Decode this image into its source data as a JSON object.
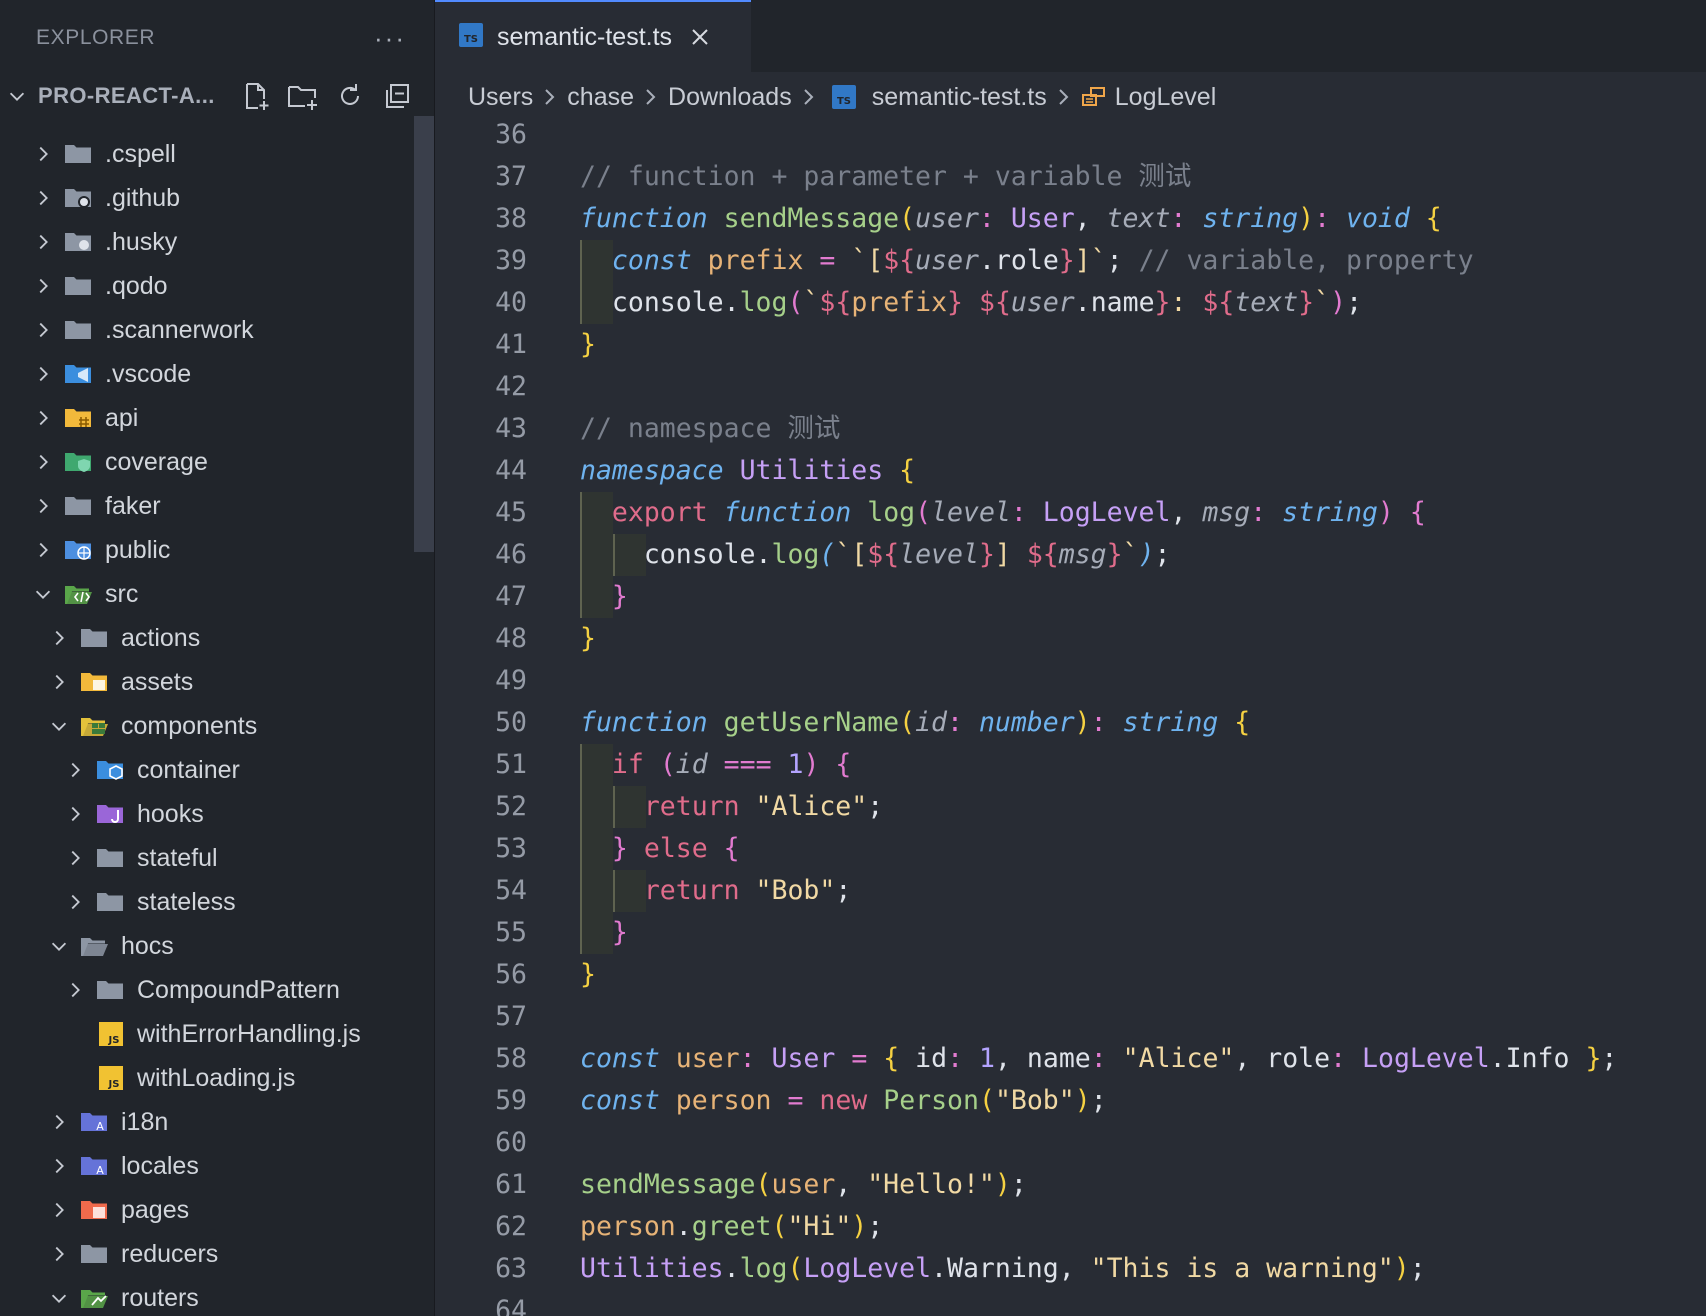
{
  "sidebar": {
    "title": "EXPLORER",
    "more": "···",
    "project": "PRO-REACT-A...",
    "items": [
      {
        "label": ".cspell",
        "depth": 0,
        "expanded": false,
        "icon": "folder-icon",
        "color": "#8d96a4"
      },
      {
        "label": ".github",
        "depth": 0,
        "expanded": false,
        "icon": "github-folder-icon",
        "color": "#8d96a4"
      },
      {
        "label": ".husky",
        "depth": 0,
        "expanded": false,
        "icon": "husky-folder-icon",
        "color": "#8d96a4"
      },
      {
        "label": ".qodo",
        "depth": 0,
        "expanded": false,
        "icon": "folder-icon",
        "color": "#8d96a4"
      },
      {
        "label": ".scannerwork",
        "depth": 0,
        "expanded": false,
        "icon": "folder-icon",
        "color": "#8d96a4"
      },
      {
        "label": ".vscode",
        "depth": 0,
        "expanded": false,
        "icon": "vscode-folder-icon",
        "color": "#3b8ede"
      },
      {
        "label": "api",
        "depth": 0,
        "expanded": false,
        "icon": "api-folder-icon",
        "color": "#f2b93b"
      },
      {
        "label": "coverage",
        "depth": 0,
        "expanded": false,
        "icon": "coverage-folder-icon",
        "color": "#3fa86f"
      },
      {
        "label": "faker",
        "depth": 0,
        "expanded": false,
        "icon": "folder-icon",
        "color": "#8d96a4"
      },
      {
        "label": "public",
        "depth": 0,
        "expanded": false,
        "icon": "public-folder-icon",
        "color": "#4d8fe0"
      },
      {
        "label": "src",
        "depth": 0,
        "expanded": true,
        "icon": "src-folder-icon",
        "color": "#5aa64a"
      },
      {
        "label": "actions",
        "depth": 1,
        "expanded": false,
        "icon": "folder-icon",
        "color": "#8d96a4"
      },
      {
        "label": "assets",
        "depth": 1,
        "expanded": false,
        "icon": "assets-folder-icon",
        "color": "#f2b93b"
      },
      {
        "label": "components",
        "depth": 1,
        "expanded": true,
        "icon": "components-folder-icon",
        "color": "#e3c13b"
      },
      {
        "label": "container",
        "depth": 2,
        "expanded": false,
        "icon": "container-folder-icon",
        "color": "#3b8ede"
      },
      {
        "label": "hooks",
        "depth": 2,
        "expanded": false,
        "icon": "hooks-folder-icon",
        "color": "#9a66d8"
      },
      {
        "label": "stateful",
        "depth": 2,
        "expanded": false,
        "icon": "folder-icon",
        "color": "#8d96a4"
      },
      {
        "label": "stateless",
        "depth": 2,
        "expanded": false,
        "icon": "folder-icon",
        "color": "#8d96a4"
      },
      {
        "label": "hocs",
        "depth": 1,
        "expanded": true,
        "icon": "folder-open-icon",
        "color": "#8d96a4"
      },
      {
        "label": "CompoundPattern",
        "depth": 2,
        "expanded": false,
        "icon": "folder-icon",
        "color": "#8d96a4"
      },
      {
        "label": "withErrorHandling.js",
        "depth": 2,
        "file": true,
        "icon": "js-file-icon",
        "color": "#f1c232"
      },
      {
        "label": "withLoading.js",
        "depth": 2,
        "file": true,
        "icon": "js-file-icon",
        "color": "#f1c232"
      },
      {
        "label": "i18n",
        "depth": 1,
        "expanded": false,
        "icon": "i18n-folder-icon",
        "color": "#6573d8"
      },
      {
        "label": "locales",
        "depth": 1,
        "expanded": false,
        "icon": "locales-folder-icon",
        "color": "#6573d8"
      },
      {
        "label": "pages",
        "depth": 1,
        "expanded": false,
        "icon": "pages-folder-icon",
        "color": "#ef6a4c"
      },
      {
        "label": "reducers",
        "depth": 1,
        "expanded": false,
        "icon": "folder-icon",
        "color": "#8d96a4"
      },
      {
        "label": "routers",
        "depth": 1,
        "expanded": true,
        "icon": "routers-folder-icon",
        "color": "#5aa64a"
      }
    ]
  },
  "tab": {
    "label": "semantic-test.ts",
    "badge": "TS"
  },
  "breadcrumbs": {
    "parts": [
      "Users",
      "chase",
      "Downloads"
    ],
    "file": "semantic-test.ts",
    "file_badge": "TS",
    "symbol": "LogLevel"
  },
  "code": {
    "first_line": 36,
    "lines": [
      [],
      [
        [
          "c",
          "// function + parameter + variable 测试"
        ]
      ],
      [
        [
          "k",
          "function"
        ],
        [
          "pl",
          " "
        ],
        [
          "f",
          "sendMessage"
        ],
        [
          "y",
          "("
        ],
        [
          "p",
          "user"
        ],
        [
          "o",
          ":"
        ],
        [
          "pl",
          " "
        ],
        [
          "t",
          "User"
        ],
        [
          "pl",
          ", "
        ],
        [
          "p",
          "text"
        ],
        [
          "o",
          ":"
        ],
        [
          "pl",
          " "
        ],
        [
          "k",
          "string"
        ],
        [
          "y",
          ")"
        ],
        [
          "o",
          ":"
        ],
        [
          "pl",
          " "
        ],
        [
          "k",
          "void"
        ],
        [
          "pl",
          " "
        ],
        [
          "y",
          "{"
        ]
      ],
      [
        [
          "pl",
          "  "
        ],
        [
          "k",
          "const"
        ],
        [
          "pl",
          " "
        ],
        [
          "v",
          "prefix"
        ],
        [
          "pl",
          " "
        ],
        [
          "o",
          "="
        ],
        [
          "pl",
          " "
        ],
        [
          "s",
          "`["
        ],
        [
          "r",
          "${"
        ],
        [
          "p",
          "user"
        ],
        [
          "pl",
          "."
        ],
        [
          "pl",
          "role"
        ],
        [
          "r",
          "}"
        ],
        [
          "s",
          "]`"
        ],
        [
          "pl",
          "; "
        ],
        [
          "c",
          "// variable, property"
        ]
      ],
      [
        [
          "pl",
          "  "
        ],
        [
          "pl",
          "console"
        ],
        [
          "pl",
          "."
        ],
        [
          "f",
          "log"
        ],
        [
          "o",
          "("
        ],
        [
          "s",
          "`"
        ],
        [
          "r",
          "${"
        ],
        [
          "v",
          "prefix"
        ],
        [
          "r",
          "}"
        ],
        [
          "s",
          " "
        ],
        [
          "r",
          "${"
        ],
        [
          "p",
          "user"
        ],
        [
          "pl",
          "."
        ],
        [
          "pl",
          "name"
        ],
        [
          "r",
          "}"
        ],
        [
          "s",
          ": "
        ],
        [
          "r",
          "${"
        ],
        [
          "p",
          "text"
        ],
        [
          "r",
          "}"
        ],
        [
          "s",
          "`"
        ],
        [
          "o",
          ")"
        ],
        [
          "pl",
          ";"
        ]
      ],
      [
        [
          "y",
          "}"
        ]
      ],
      [],
      [
        [
          "c",
          "// namespace 测试"
        ]
      ],
      [
        [
          "k",
          "namespace"
        ],
        [
          "pl",
          " "
        ],
        [
          "t",
          "Utilities"
        ],
        [
          "pl",
          " "
        ],
        [
          "y",
          "{"
        ]
      ],
      [
        [
          "pl",
          "  "
        ],
        [
          "r",
          "export"
        ],
        [
          "pl",
          " "
        ],
        [
          "k",
          "function"
        ],
        [
          "pl",
          " "
        ],
        [
          "f",
          "log"
        ],
        [
          "o",
          "("
        ],
        [
          "p",
          "level"
        ],
        [
          "o",
          ":"
        ],
        [
          "pl",
          " "
        ],
        [
          "t",
          "LogLevel"
        ],
        [
          "pl",
          ", "
        ],
        [
          "p",
          "msg"
        ],
        [
          "o",
          ":"
        ],
        [
          "pl",
          " "
        ],
        [
          "k",
          "string"
        ],
        [
          "o",
          ")"
        ],
        [
          "pl",
          " "
        ],
        [
          "o",
          "{"
        ]
      ],
      [
        [
          "pl",
          "    "
        ],
        [
          "pl",
          "console"
        ],
        [
          "pl",
          "."
        ],
        [
          "f",
          "log"
        ],
        [
          "k",
          "("
        ],
        [
          "s",
          "`["
        ],
        [
          "r",
          "${"
        ],
        [
          "p",
          "level"
        ],
        [
          "r",
          "}"
        ],
        [
          "s",
          "] "
        ],
        [
          "r",
          "${"
        ],
        [
          "p",
          "msg"
        ],
        [
          "r",
          "}"
        ],
        [
          "s",
          "`"
        ],
        [
          "k",
          ")"
        ],
        [
          "pl",
          ";"
        ]
      ],
      [
        [
          "pl",
          "  "
        ],
        [
          "o",
          "}"
        ]
      ],
      [
        [
          "y",
          "}"
        ]
      ],
      [],
      [
        [
          "k",
          "function"
        ],
        [
          "pl",
          " "
        ],
        [
          "f",
          "getUserName"
        ],
        [
          "y",
          "("
        ],
        [
          "p",
          "id"
        ],
        [
          "o",
          ":"
        ],
        [
          "pl",
          " "
        ],
        [
          "k",
          "number"
        ],
        [
          "y",
          ")"
        ],
        [
          "o",
          ":"
        ],
        [
          "pl",
          " "
        ],
        [
          "k",
          "string"
        ],
        [
          "pl",
          " "
        ],
        [
          "y",
          "{"
        ]
      ],
      [
        [
          "pl",
          "  "
        ],
        [
          "r",
          "if"
        ],
        [
          "pl",
          " "
        ],
        [
          "o",
          "("
        ],
        [
          "p",
          "id"
        ],
        [
          "pl",
          " "
        ],
        [
          "o",
          "==="
        ],
        [
          "pl",
          " "
        ],
        [
          "n",
          "1"
        ],
        [
          "o",
          ")"
        ],
        [
          "pl",
          " "
        ],
        [
          "o",
          "{"
        ]
      ],
      [
        [
          "pl",
          "    "
        ],
        [
          "r",
          "return"
        ],
        [
          "pl",
          " "
        ],
        [
          "s",
          "\"Alice\""
        ],
        [
          "pl",
          ";"
        ]
      ],
      [
        [
          "pl",
          "  "
        ],
        [
          "o",
          "}"
        ],
        [
          "pl",
          " "
        ],
        [
          "r",
          "else"
        ],
        [
          "pl",
          " "
        ],
        [
          "o",
          "{"
        ]
      ],
      [
        [
          "pl",
          "    "
        ],
        [
          "r",
          "return"
        ],
        [
          "pl",
          " "
        ],
        [
          "s",
          "\"Bob\""
        ],
        [
          "pl",
          ";"
        ]
      ],
      [
        [
          "pl",
          "  "
        ],
        [
          "o",
          "}"
        ]
      ],
      [
        [
          "y",
          "}"
        ]
      ],
      [],
      [
        [
          "k",
          "const"
        ],
        [
          "pl",
          " "
        ],
        [
          "v",
          "user"
        ],
        [
          "o",
          ":"
        ],
        [
          "pl",
          " "
        ],
        [
          "t",
          "User"
        ],
        [
          "pl",
          " "
        ],
        [
          "o",
          "="
        ],
        [
          "pl",
          " "
        ],
        [
          "y",
          "{"
        ],
        [
          "pl",
          " id"
        ],
        [
          "o",
          ":"
        ],
        [
          "pl",
          " "
        ],
        [
          "n",
          "1"
        ],
        [
          "pl",
          ", name"
        ],
        [
          "o",
          ":"
        ],
        [
          "pl",
          " "
        ],
        [
          "s",
          "\"Alice\""
        ],
        [
          "pl",
          ", role"
        ],
        [
          "o",
          ":"
        ],
        [
          "pl",
          " "
        ],
        [
          "t",
          "LogLevel"
        ],
        [
          "pl",
          "."
        ],
        [
          "pl",
          "Info"
        ],
        [
          "pl",
          " "
        ],
        [
          "y",
          "}"
        ],
        [
          "pl",
          ";"
        ]
      ],
      [
        [
          "k",
          "const"
        ],
        [
          "pl",
          " "
        ],
        [
          "v",
          "person"
        ],
        [
          "pl",
          " "
        ],
        [
          "o",
          "="
        ],
        [
          "pl",
          " "
        ],
        [
          "r",
          "new"
        ],
        [
          "pl",
          " "
        ],
        [
          "f",
          "Person"
        ],
        [
          "y",
          "("
        ],
        [
          "s",
          "\"Bob\""
        ],
        [
          "y",
          ")"
        ],
        [
          "pl",
          ";"
        ]
      ],
      [],
      [
        [
          "f",
          "sendMessage"
        ],
        [
          "y",
          "("
        ],
        [
          "v",
          "user"
        ],
        [
          "pl",
          ", "
        ],
        [
          "s",
          "\"Hello!\""
        ],
        [
          "y",
          ")"
        ],
        [
          "pl",
          ";"
        ]
      ],
      [
        [
          "v",
          "person"
        ],
        [
          "pl",
          "."
        ],
        [
          "f",
          "greet"
        ],
        [
          "y",
          "("
        ],
        [
          "s",
          "\"Hi\""
        ],
        [
          "y",
          ")"
        ],
        [
          "pl",
          ";"
        ]
      ],
      [
        [
          "t",
          "Utilities"
        ],
        [
          "pl",
          "."
        ],
        [
          "f",
          "log"
        ],
        [
          "y",
          "("
        ],
        [
          "t",
          "LogLevel"
        ],
        [
          "pl",
          "."
        ],
        [
          "pl",
          "Warning"
        ],
        [
          "pl",
          ", "
        ],
        [
          "s",
          "\"This is a warning\""
        ],
        [
          "y",
          ")"
        ],
        [
          "pl",
          ";"
        ]
      ],
      []
    ]
  }
}
